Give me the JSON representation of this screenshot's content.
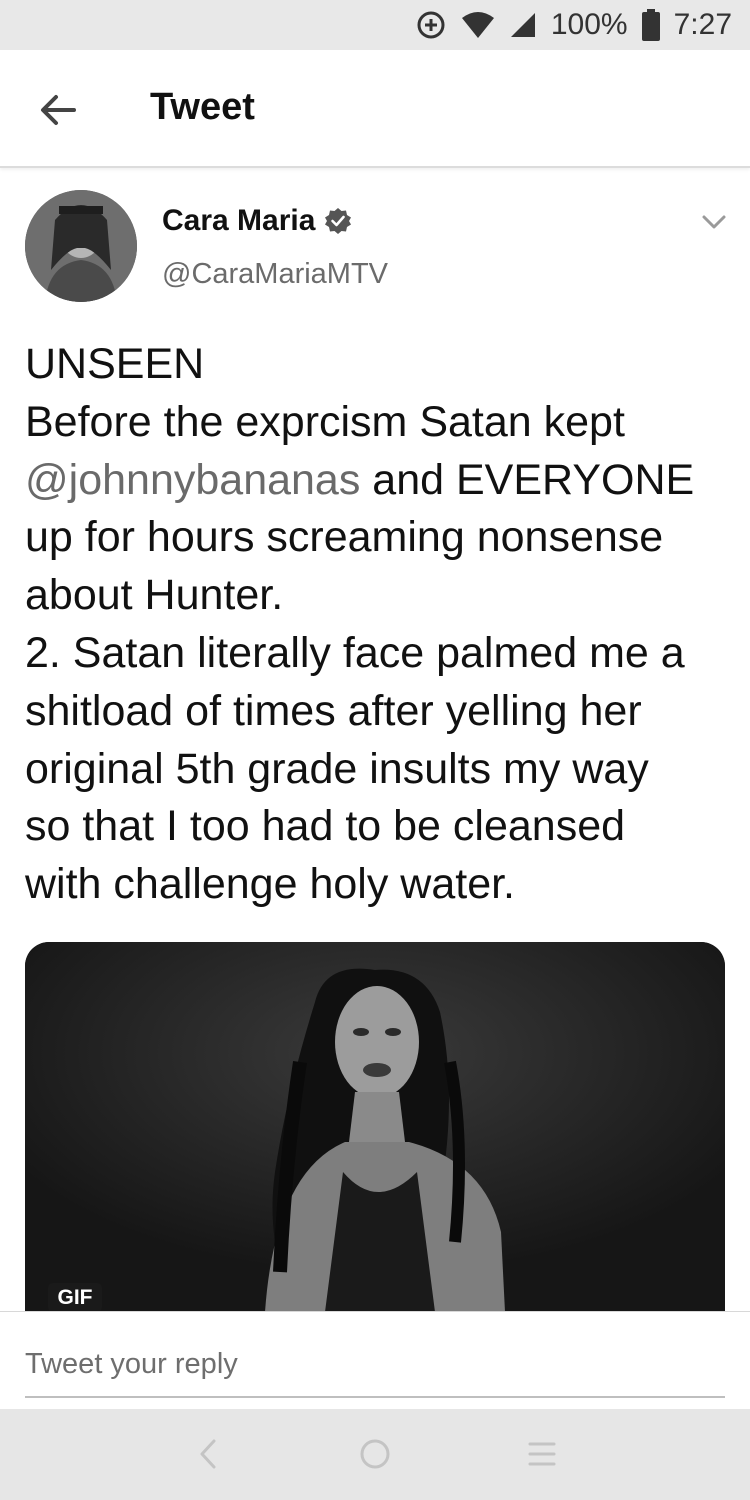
{
  "status_bar": {
    "battery": "100%",
    "time": "7:27",
    "icons": [
      "data-saver-icon",
      "wifi-icon",
      "signal-icon",
      "battery-icon"
    ]
  },
  "header": {
    "back_icon": "arrow-left-icon",
    "title": "Tweet"
  },
  "tweet": {
    "display_name": "Cara Maria",
    "verified_icon": "verified-badge-icon",
    "handle": "@CaraMariaMTV",
    "menu_icon": "chevron-down-icon",
    "lines": [
      {
        "text": "UNSEEN"
      },
      {
        "text": "Before the exprcism Satan kept"
      },
      {
        "mention": "@johnnybananas",
        "text": " and EVERYONE"
      },
      {
        "text": "up for hours screaming nonsense"
      },
      {
        "text": "about Hunter."
      },
      {
        "text": "2. Satan literally face palmed me a"
      },
      {
        "text": "shitload of times after yelling her"
      },
      {
        "text": "original 5th grade insults my way"
      },
      {
        "text": "so that I too had to be cleansed"
      },
      {
        "text": "with challenge holy water."
      }
    ],
    "media": {
      "badge": "GIF"
    }
  },
  "reply": {
    "placeholder": "Tweet your reply"
  },
  "nav_bar": {
    "icons": [
      "back-nav-icon",
      "home-nav-icon",
      "recents-nav-icon"
    ]
  },
  "colors": {
    "status_bar_bg": "#e8e8e8",
    "nav_bar_bg": "#e6e6e6",
    "mention": "#6a6a6a",
    "secondary_text": "#6b6b6b"
  }
}
